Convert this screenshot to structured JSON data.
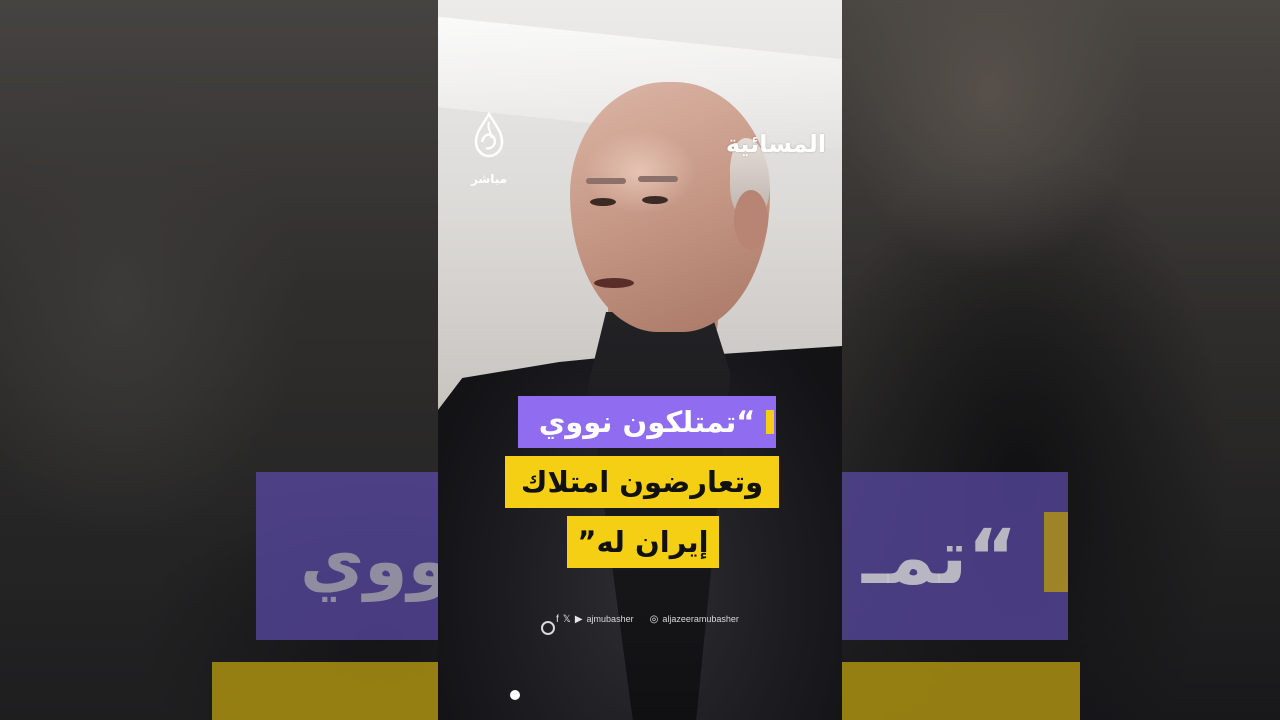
{
  "channel": {
    "aljazeera_logo_sub": "مباشر",
    "partner_logo": "المسائية"
  },
  "captions": {
    "line1": "“تمتلكون نووي",
    "line2": "وتعارضون امتلاك",
    "line3": "إيران له”"
  },
  "backdrop": {
    "caption_left": "“تمـ",
    "caption_right": "نووي"
  },
  "social": {
    "icons": [
      "facebook-icon",
      "x-icon",
      "youtube-icon"
    ],
    "handle_1": "ajmubasher",
    "handle_2": "aljazeeramubasher"
  },
  "colors": {
    "caption_purple": "#8f6cf0",
    "caption_yellow": "#f5cf14"
  }
}
